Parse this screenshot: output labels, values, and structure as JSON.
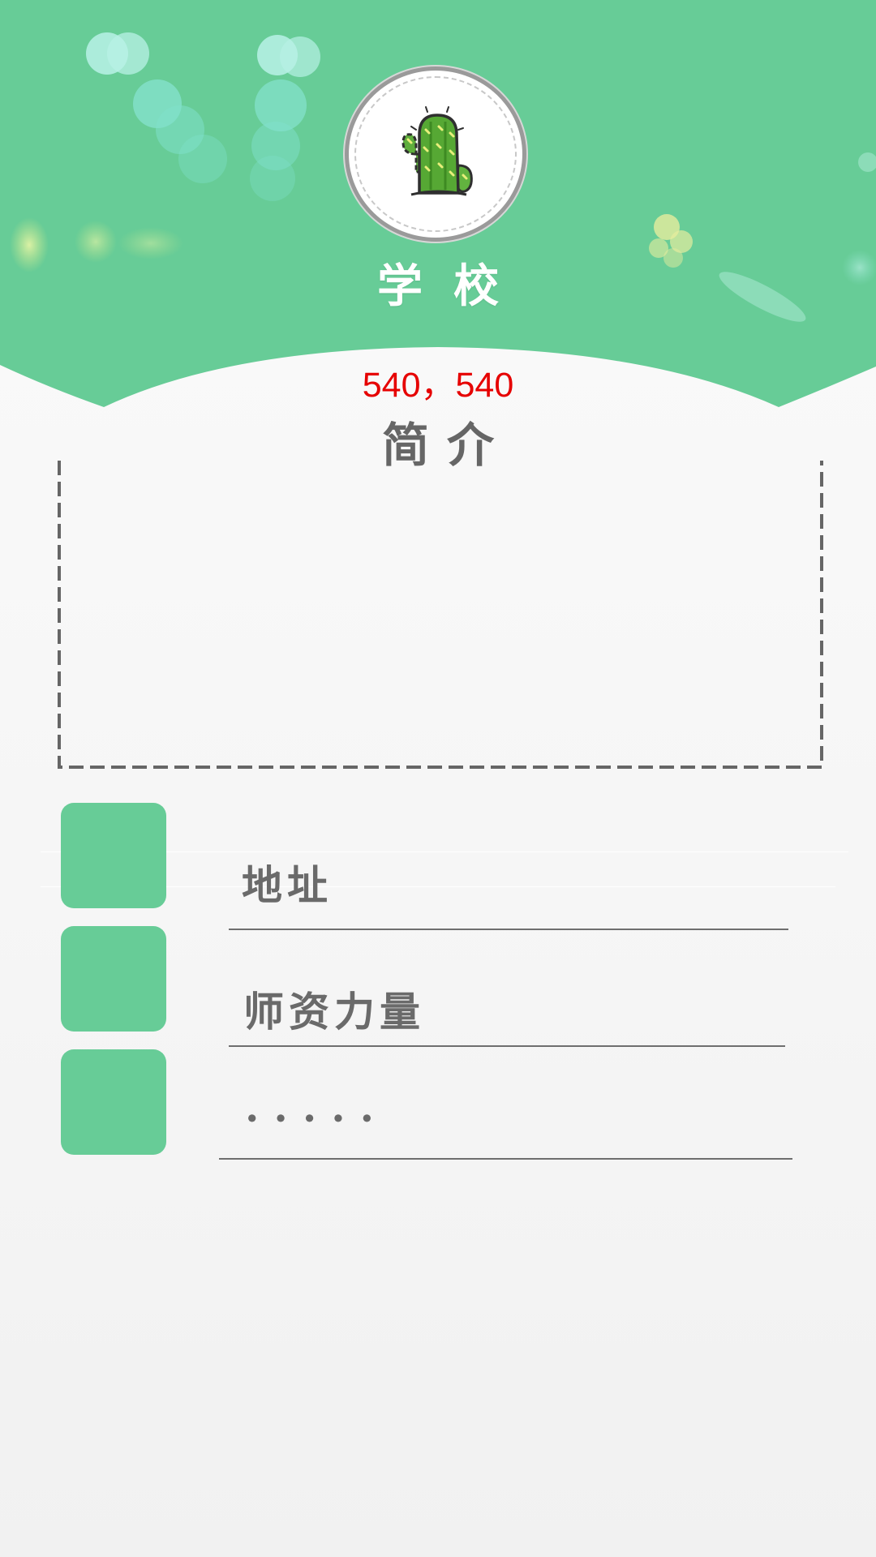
{
  "header": {
    "title": "学校",
    "coords": "540，540",
    "logo_icon": "cactus-icon",
    "background_color": "#67cc97"
  },
  "intro": {
    "title": "简介"
  },
  "items": [
    {
      "label": "地址",
      "icon_color": "#67cc97"
    },
    {
      "label": "师资力量",
      "icon_color": "#67cc97"
    },
    {
      "label": ".....",
      "icon_color": "#67cc97"
    }
  ]
}
